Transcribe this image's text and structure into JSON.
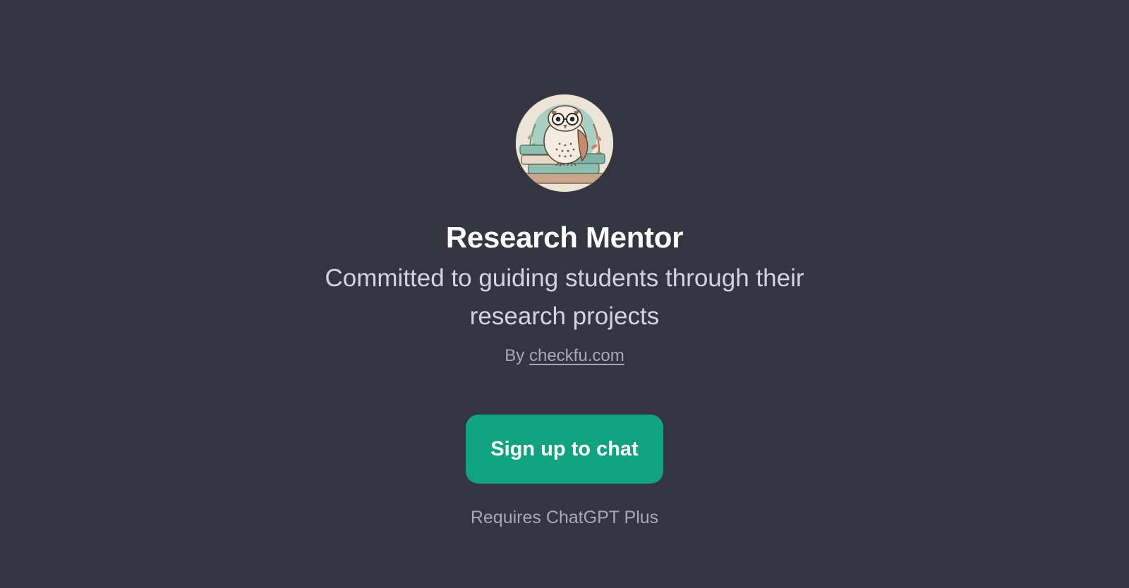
{
  "gpt": {
    "name": "Research Mentor",
    "description": "Committed to guiding students through their research projects",
    "by_prefix": "By",
    "author_link": "checkfu.com",
    "avatar_icon": "owl-on-books-icon"
  },
  "actions": {
    "signup_label": "Sign up to chat"
  },
  "footer": {
    "requirement": "Requires ChatGPT Plus"
  },
  "colors": {
    "background": "#343541",
    "accent": "#10a37f",
    "title": "#ffffff",
    "muted": "#a9a9b3"
  }
}
